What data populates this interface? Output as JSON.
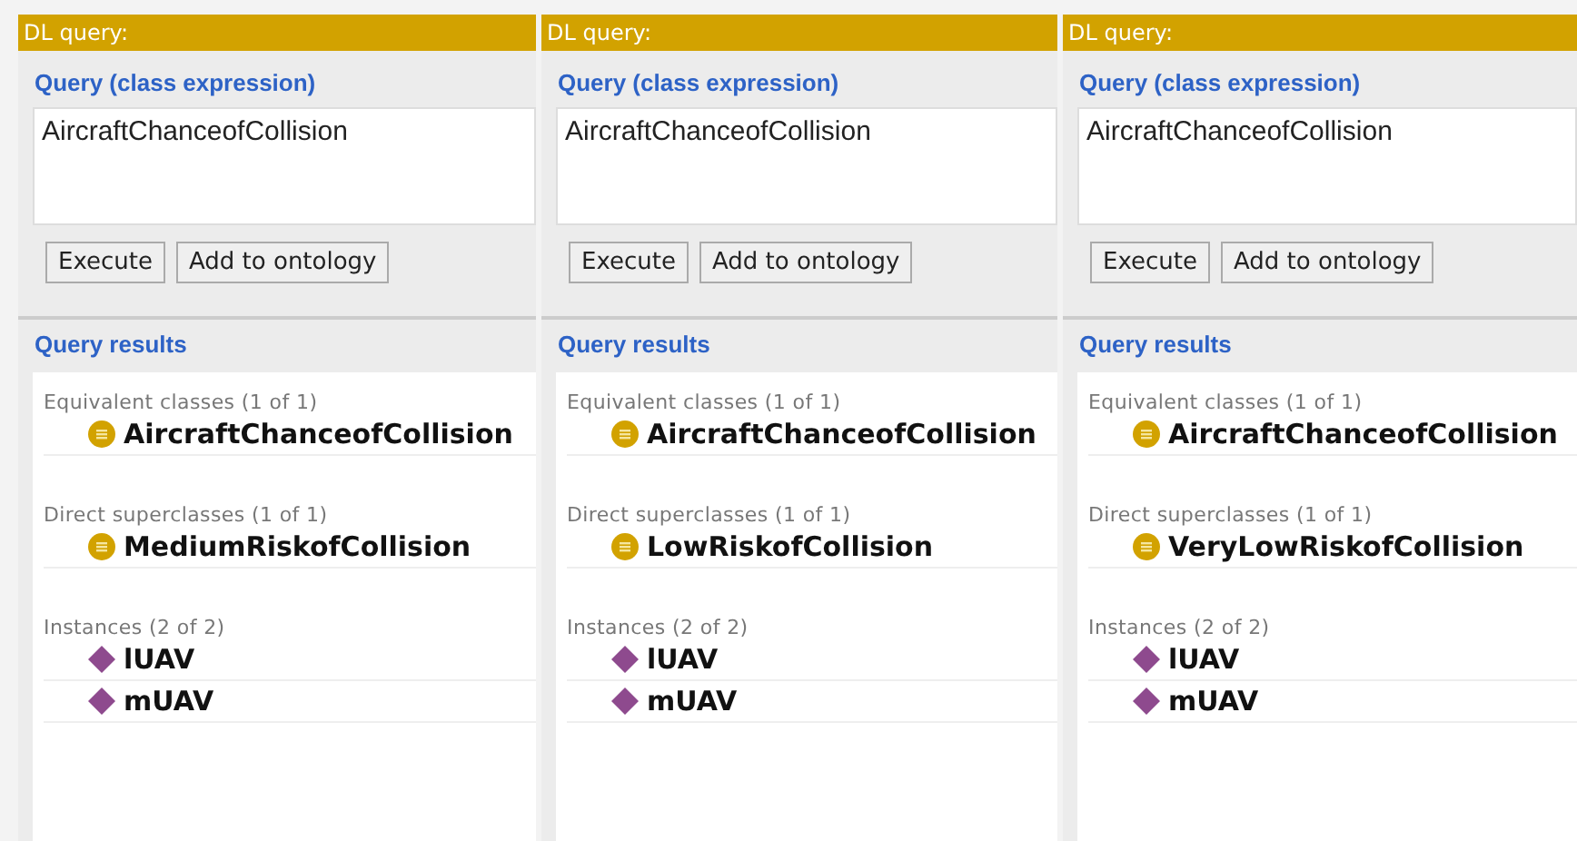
{
  "panels": [
    {
      "title": "DL query:",
      "query_label": "Query (class expression)",
      "query": "AircraftChanceofCollision",
      "buttons": [
        "Execute",
        "Add to ontology"
      ],
      "results_label": "Query results",
      "sections": [
        {
          "heading": "Equivalent classes (1 of 1)",
          "items": [
            {
              "kind": "class",
              "label": "AircraftChanceofCollision"
            }
          ]
        },
        {
          "heading": "Direct superclasses (1 of 1)",
          "items": [
            {
              "kind": "class",
              "label": "MediumRiskofCollision"
            }
          ]
        },
        {
          "heading": "Instances (2 of 2)",
          "items": [
            {
              "kind": "individual",
              "label": "lUAV"
            },
            {
              "kind": "individual",
              "label": "mUAV"
            }
          ]
        }
      ]
    },
    {
      "title": "DL query:",
      "query_label": "Query (class expression)",
      "query": "AircraftChanceofCollision",
      "buttons": [
        "Execute",
        "Add to ontology"
      ],
      "results_label": "Query results",
      "sections": [
        {
          "heading": "Equivalent classes (1 of 1)",
          "items": [
            {
              "kind": "class",
              "label": "AircraftChanceofCollision"
            }
          ]
        },
        {
          "heading": "Direct superclasses (1 of 1)",
          "items": [
            {
              "kind": "class",
              "label": "LowRiskofCollision"
            }
          ]
        },
        {
          "heading": "Instances (2 of 2)",
          "items": [
            {
              "kind": "individual",
              "label": "lUAV"
            },
            {
              "kind": "individual",
              "label": "mUAV"
            }
          ]
        }
      ]
    },
    {
      "title": "DL query:",
      "query_label": "Query (class expression)",
      "query": "AircraftChanceofCollision",
      "buttons": [
        "Execute",
        "Add to ontology"
      ],
      "results_label": "Query results",
      "sections": [
        {
          "heading": "Equivalent classes (1 of 1)",
          "items": [
            {
              "kind": "class",
              "label": "AircraftChanceofCollision"
            }
          ]
        },
        {
          "heading": "Direct superclasses (1 of 1)",
          "items": [
            {
              "kind": "class",
              "label": "VeryLowRiskofCollision"
            }
          ]
        },
        {
          "heading": "Instances (2 of 2)",
          "items": [
            {
              "kind": "individual",
              "label": "lUAV"
            },
            {
              "kind": "individual",
              "label": "mUAV"
            }
          ]
        }
      ]
    }
  ]
}
